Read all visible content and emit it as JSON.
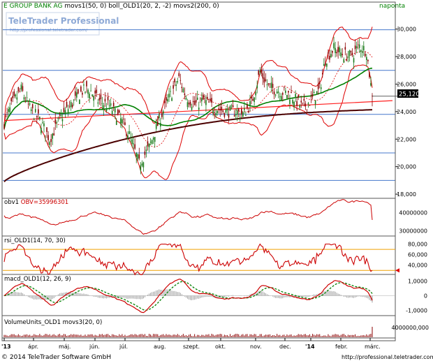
{
  "header": {
    "title_green": "E GROUP BANK AG",
    "title_rest": " movs1(50, 0)  boll_OLD1(20, 2, -2)  movs2(200, 0)",
    "period": "naponta"
  },
  "watermark": {
    "brand": "TeleTrader Professional",
    "url": "http://professional.teletrader.com/"
  },
  "last_price_label": "25,120",
  "footer": {
    "copyright": "© 2014 TeleTrader Software GmbH",
    "url": "http://professional.teletrader.com/"
  },
  "x_axis": {
    "ticks": [
      {
        "label": "'13",
        "bold": true
      },
      {
        "label": "ápr.",
        "bold": false
      },
      {
        "label": "máj.",
        "bold": false
      },
      {
        "label": "jún.",
        "bold": false
      },
      {
        "label": "júl.",
        "bold": false
      },
      {
        "label": "aug.",
        "bold": false
      },
      {
        "label": "szept.",
        "bold": false
      },
      {
        "label": "okt.",
        "bold": false
      },
      {
        "label": "nov.",
        "bold": false
      },
      {
        "label": "dec.",
        "bold": false
      },
      {
        "label": "'14",
        "bold": true
      },
      {
        "label": "febr.",
        "bold": false
      },
      {
        "label": "márc.",
        "bold": false
      }
    ]
  },
  "colors": {
    "price_up": "#1a7a1a",
    "price_down": "#8b0000",
    "sma50": "#008000",
    "sma200": "#4b0000",
    "bollinger": "#dd0000",
    "hline": "#4477cc",
    "indicator_line": "#cc0000",
    "rsi_band": "#f0a000",
    "header_green": "#008000"
  },
  "chart_data": [
    {
      "type": "candlestick",
      "panel": "price",
      "title": "E GROUP BANK AG",
      "ylim": [
        17.8,
        31.2
      ],
      "yticks": [
        "30,000",
        "28,000",
        "26,000",
        "24,000",
        "22,000",
        "20,000",
        "18,000"
      ],
      "horizontal_lines": [
        29.95,
        27.0,
        23.8,
        21.0,
        19.0
      ],
      "trendline": {
        "from": [
          0,
          23.35
        ],
        "to": [
          250,
          24.7
        ]
      },
      "close_series_approx": [
        {
          "date": "2013-01",
          "close": 24.5
        },
        {
          "date": "2013-02",
          "close": 23.9
        },
        {
          "date": "2013-03",
          "close": 22.8
        },
        {
          "date": "2013-04",
          "close": 25.6
        },
        {
          "date": "2013-05",
          "close": 24.8
        },
        {
          "date": "2013-06",
          "close": 23.0
        },
        {
          "date": "2013-07",
          "close": 20.2
        },
        {
          "date": "2013-07b",
          "close": 21.5
        },
        {
          "date": "2013-08",
          "close": 26.3
        },
        {
          "date": "2013-09",
          "close": 24.5
        },
        {
          "date": "2013-10",
          "close": 23.8
        },
        {
          "date": "2013-11",
          "close": 26.1
        },
        {
          "date": "2013-12",
          "close": 24.5
        },
        {
          "date": "2014-01",
          "close": 28.5
        },
        {
          "date": "2014-02",
          "close": 27.9
        },
        {
          "date": "2014-03",
          "close": 25.12
        }
      ],
      "overlays": [
        "movs1(50, 0)",
        "boll_OLD1(20, 2, -2)",
        "movs2(200, 0)"
      ]
    },
    {
      "type": "line",
      "panel": "obv",
      "title": "obv1",
      "value_label": "OBV=35996301",
      "ylim": [
        28000000,
        47000000
      ],
      "yticks": [
        "40000000",
        "30000000"
      ]
    },
    {
      "type": "line",
      "panel": "rsi",
      "title": "rsi_OLD1(14, 70, 30)",
      "ylim": [
        25,
        90
      ],
      "yticks": [
        "80,000",
        "60,000",
        "40,000"
      ],
      "bands": [
        70,
        30
      ]
    },
    {
      "type": "line",
      "panel": "macd",
      "title": "macd_OLD1(12, 26, 9)",
      "ylim": [
        -1.25,
        1.25
      ],
      "yticks": [
        "1,0000",
        "0",
        "-1,0000"
      ]
    },
    {
      "type": "bar",
      "panel": "volume",
      "title": "VolumeUnits_OLD1 movs3(20, 0)",
      "yticks": [
        "4000000,000"
      ]
    }
  ]
}
